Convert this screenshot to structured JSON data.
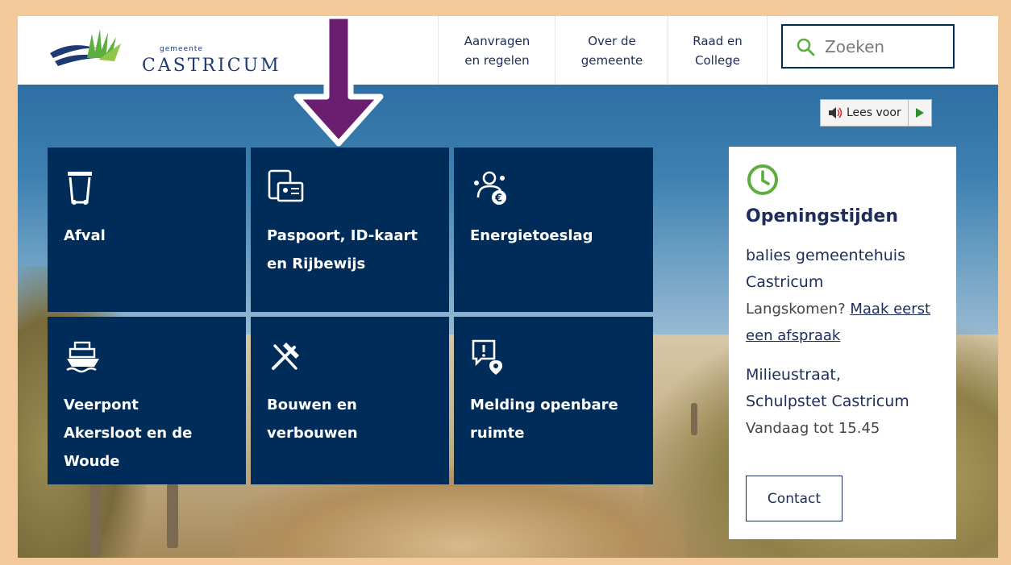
{
  "header": {
    "logo": {
      "small": "gemeente",
      "name": "CASTRICUM"
    },
    "nav": [
      {
        "label": "Aanvragen\nen regelen"
      },
      {
        "label": "Over de\ngemeente"
      },
      {
        "label": "Raad en\nCollege"
      }
    ],
    "search": {
      "placeholder": "Zoeken"
    }
  },
  "read_aloud": {
    "label": "Lees voor"
  },
  "tiles": [
    {
      "label": "Afval",
      "icon": "trash-bin-icon"
    },
    {
      "label": "Paspoort, ID-kaart\nen Rijbewijs",
      "icon": "id-card-icon"
    },
    {
      "label": "Energietoeslag",
      "icon": "energy-allowance-icon"
    },
    {
      "label": "Veerpont\nAkersloot en de\nWoude",
      "icon": "ferry-icon"
    },
    {
      "label": "Bouwen en\nverbouwen",
      "icon": "hammer-icon"
    },
    {
      "label": "Melding openbare\nruimte",
      "icon": "report-location-icon"
    }
  ],
  "opening_hours": {
    "title": "Openingstijden",
    "location1": "balies gemeentehuis\nCastricum",
    "text1_prefix": "Langskomen? ",
    "text1_link": "Maak eerst een afspraak",
    "location2": "Milieustraat,\nSchulpstet Castricum",
    "text2": "Vandaag tot 15.45",
    "contact_label": "Contact"
  },
  "colors": {
    "tile_bg": "#002c5a",
    "accent_green": "#5cae3e",
    "arrow": "#6b1e6f",
    "frame": "#f2c99a"
  }
}
